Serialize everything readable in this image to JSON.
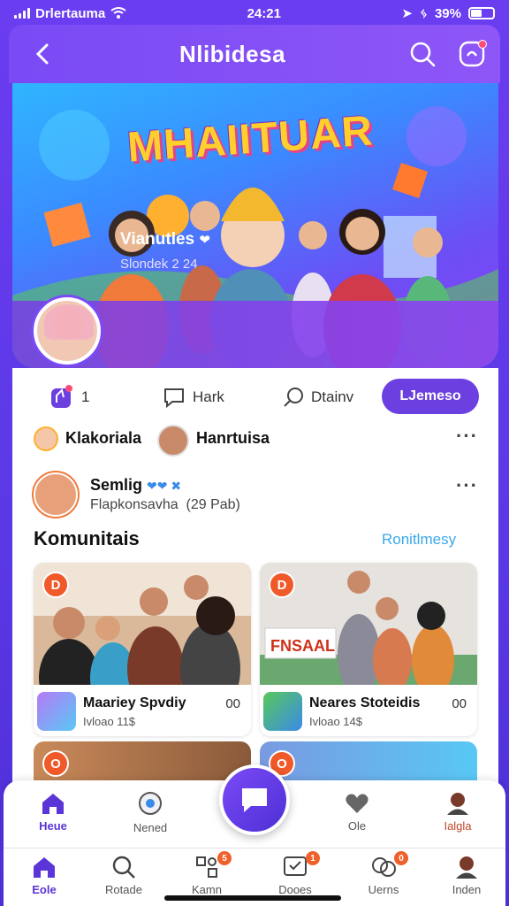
{
  "status_bar": {
    "carrier": "Drlertauma",
    "time": "24:21",
    "battery": "39%"
  },
  "header": {
    "title": "Nlibidesa"
  },
  "banner": {
    "title": "MHAIITUAR",
    "channel_name": "Vianutles",
    "channel_sub": "Slondek 2 24"
  },
  "actions": {
    "likes": "1",
    "comment": "Hark",
    "search": "Dtainv",
    "subscribe": "LJemeso"
  },
  "people_row": {
    "user1": "Klakoriala",
    "user2": "Hanrtuisa"
  },
  "post": {
    "name": "Semlig",
    "sub": "Flapkonsavha",
    "sub2": "(29 Pab)"
  },
  "section": {
    "title": "Komunitais",
    "link": "Ronitlmesy"
  },
  "cards": [
    {
      "badge": "D",
      "title": "Maariey Spvdiy",
      "meta": "Ivloao 11$",
      "count": "00"
    },
    {
      "badge": "D",
      "title": "Neares Stoteidis",
      "meta": "Ivloao 14$",
      "count": "00",
      "sign": "FNSAAL"
    }
  ],
  "peek_cards": [
    {
      "badge": "O"
    },
    {
      "badge": "O"
    }
  ],
  "tabs_top": [
    "Heue",
    "Nened",
    "Ole",
    "Ialgla"
  ],
  "tabs_bottom": [
    "Eole",
    "Rotade",
    "Kamn",
    "Dooes",
    "Uerns",
    "Inden"
  ],
  "colors": {
    "primary": "#6b3fe0",
    "accent": "#f05a2a",
    "link": "#3aa8e8"
  }
}
